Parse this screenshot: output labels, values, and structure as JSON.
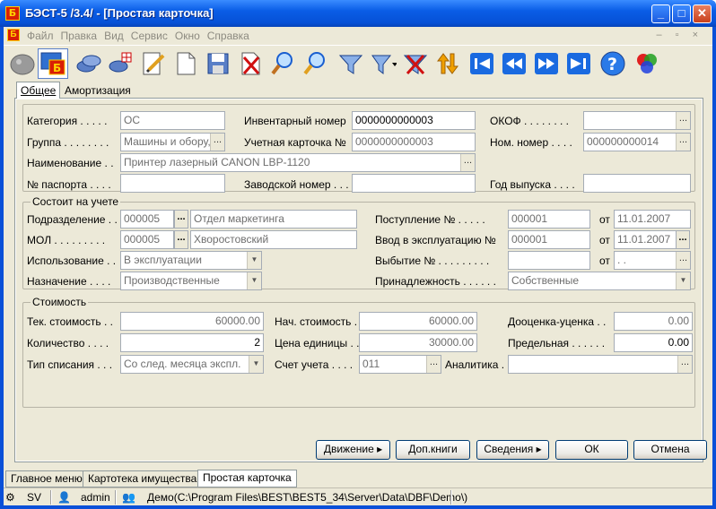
{
  "window": {
    "title": "БЭСТ-5 /3.4/ - [Простая карточка]",
    "app_icon_letter": "Б"
  },
  "menu": {
    "items": [
      "Файл",
      "Правка",
      "Вид",
      "Сервис",
      "Окно",
      "Справка"
    ],
    "mdi_controls": "– ▫ ×"
  },
  "toolbar": {
    "icons": [
      "rock-icon",
      "card-app-icon",
      "disks-icon",
      "disks-grid-icon",
      "pencil-icon",
      "new-document-icon",
      "save-icon",
      "delete-icon",
      "find-icon",
      "find-next-icon",
      "filter-icon",
      "filter-dropdown-icon",
      "clear-filter-icon",
      "sort-icon",
      "first-icon",
      "prev-icon",
      "next-icon",
      "last-icon",
      "help-icon",
      "palette-icon"
    ]
  },
  "tabs": {
    "general": "Общее",
    "depreciation": "Амортизация"
  },
  "top_section": {
    "category_label": "Категория . . . . .",
    "category_value": "ОС",
    "group_label": "Группа . . . . . . . .",
    "group_value": "Машины и обору,",
    "name_label": "Наименование . .",
    "name_value": "Принтер лазерный CANON LBP-1120",
    "passport_label": "№ паспорта . . . .",
    "passport_value": "",
    "inventory_label": "Инвентарный номер",
    "inventory_value": "0000000000003",
    "card_label": "Учетная карточка №",
    "card_value": "0000000000003",
    "factory_label": "Заводской номер . . .",
    "factory_value": "",
    "okof_label": "ОКОФ . . . . . . . .",
    "okof_value": "",
    "nom_label": "Ном. номер . . . .",
    "nom_value": "000000000014",
    "year_label": "Год выпуска . . . .",
    "year_value": ""
  },
  "registered": {
    "title": "Состоит на учете",
    "division_label": "Подразделение . .",
    "division_code": "000005",
    "division_name": "Отдел маркетинга",
    "mol_label": "МОЛ . . . . . . . . .",
    "mol_code": "000005",
    "mol_name": "Хворостовский",
    "usage_label": "Использование . .",
    "usage_value": "В эксплуатации",
    "purpose_label": "Назначение . . . .",
    "purpose_value": "Производственные",
    "receipt_label": "Поступление    № . . . . .",
    "receipt_no": "000001",
    "receipt_from_label": "от",
    "receipt_date": "11.01.2007",
    "commission_label": "Ввод в эксплуатацию   №",
    "commission_no": "000001",
    "commission_from_label": "от",
    "commission_date": "11.01.2007",
    "disposal_label": "Выбытие  № . . . . . . . . .",
    "disposal_no": "",
    "disposal_from_label": "от",
    "disposal_date": "  .  .",
    "ownership_label": "Принадлежность . . . . . .",
    "ownership_value": "Собственные"
  },
  "cost": {
    "title": "Стоимость",
    "current_label": "Тек. стоимость . .",
    "current_value": "60000.00",
    "quantity_label": "Количество . . . .",
    "quantity_value": "2",
    "writeoff_label": "Тип списания . . .",
    "writeoff_value": "Со след. месяца экспл.",
    "initial_label": "Нач. стоимость . .",
    "initial_value": "60000.00",
    "unit_label": "Цена единицы . .",
    "unit_value": "30000.00",
    "account_label": "Счет учета . . . .",
    "account_value": "011",
    "revaluation_label": "Дооценка-уценка . .",
    "revaluation_value": "0.00",
    "limit_label": "Предельная . . . . . .",
    "limit_value": "0.00",
    "analytics_label": "Аналитика . . . .",
    "analytics_value": ""
  },
  "buttons": {
    "movement": "Движение",
    "extra_books": "Доп.книги",
    "info": "Сведения",
    "ok": "ОК",
    "cancel": "Отмена"
  },
  "doc_tabs": [
    "Главное меню",
    "Картотека имущества",
    "Простая карточка"
  ],
  "status": {
    "server": "SV",
    "user": "admin",
    "database": "Демо(C:\\Program Files\\BEST\\BEST5_34\\Server\\Data\\DBF\\Demo\\)"
  }
}
